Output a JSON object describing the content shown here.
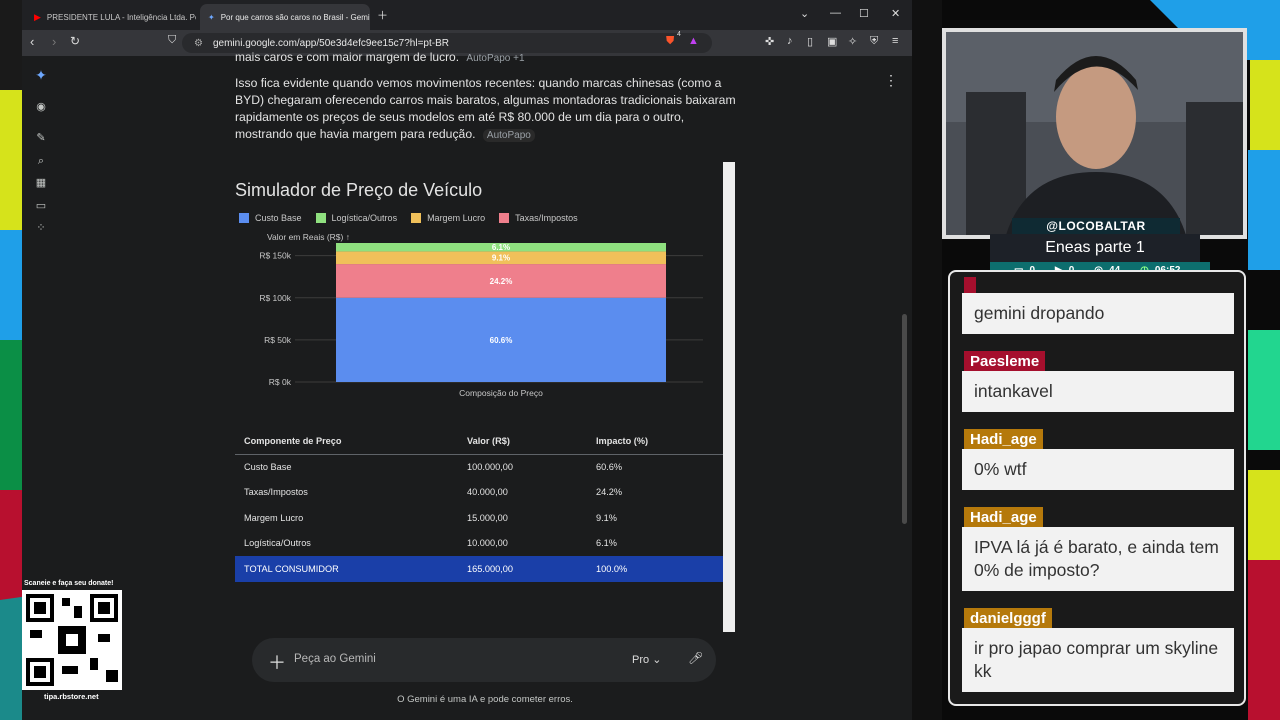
{
  "browser": {
    "tabs": [
      {
        "title": "PRESIDENTE LULA - Inteligência Ltda. Podcast",
        "active": false
      },
      {
        "title": "Por que carros são caros no Brasil - Gemini",
        "active": true
      }
    ],
    "url": "gemini.google.com/app/50e3d4efc9ee15c7?hl=pt-BR",
    "brave_badge": "4"
  },
  "gemini": {
    "cut_line": "mais caros e com maior margem de lucro.",
    "cut_source": "AutoPapo +1",
    "paragraph": "Isso fica evidente quando vemos movimentos recentes: quando marcas chinesas (como a BYD) chegaram oferecendo carros mais baratos, algumas montadoras tradicionais baixaram rapidamente os preços de seus modelos em até R$ 80.000 de um dia para o outro, mostrando que havia margem para redução.",
    "source_chip": "AutoPapo",
    "canvas_title": "Simulador de Preço de Veículo",
    "table": {
      "headers": [
        "Componente de Preço",
        "Valor (R$)",
        "Impacto (%)"
      ],
      "rows": [
        [
          "Custo Base",
          "100.000,00",
          "60.6%"
        ],
        [
          "Taxas/Impostos",
          "40.000,00",
          "24.2%"
        ],
        [
          "Margem Lucro",
          "15.000,00",
          "9.1%"
        ],
        [
          "Logística/Outros",
          "10.000,00",
          "6.1%"
        ],
        [
          "TOTAL CONSUMIDOR",
          "165.000,00",
          "100.0%"
        ]
      ]
    },
    "input_placeholder": "Peça ao Gemini",
    "model_label": "Pro",
    "disclaimer": "O Gemini é uma IA e pode cometer erros."
  },
  "chart_data": {
    "type": "bar",
    "stacked": true,
    "categories": [
      "Composição do Preço"
    ],
    "series": [
      {
        "name": "Custo Base",
        "values": [
          100000
        ],
        "label": "60.6%",
        "color": "#5b8def"
      },
      {
        "name": "Taxas/Impostos",
        "values": [
          40000
        ],
        "label": "24.2%",
        "color": "#ef7f8c"
      },
      {
        "name": "Margem Lucro",
        "values": [
          15000
        ],
        "label": "9.1%",
        "color": "#f0c05a"
      },
      {
        "name": "Logística/Outros",
        "values": [
          10000
        ],
        "label": "6.1%",
        "color": "#8fe07f"
      }
    ],
    "legend_order": [
      "Custo Base",
      "Logística/Outros",
      "Margem Lucro",
      "Taxas/Impostos"
    ],
    "ylabel": "Valor em Reais (R$) ↑",
    "yticks": [
      "R$ 0k",
      "R$ 50k",
      "R$ 100k",
      "R$ 150k"
    ],
    "ylim": [
      0,
      165000
    ],
    "grid": true,
    "legend_position": "top-left"
  },
  "stream": {
    "handle": "@LOCOBALTAR",
    "title": "Eneas parte 1",
    "stats": [
      "0",
      "0",
      "44",
      "06:52"
    ]
  },
  "chat": [
    {
      "user": "",
      "message": "gemini dropando",
      "color": "#a50f2d"
    },
    {
      "user": "Paesleme",
      "message": "intankavel",
      "color": "#a50f2d"
    },
    {
      "user": "Hadi_age",
      "message": "0% wtf",
      "color": "#b5790b"
    },
    {
      "user": "Hadi_age",
      "message": "IPVA lá já é barato, e ainda tem 0% de imposto?",
      "color": "#b5790b"
    },
    {
      "user": "danielgggf",
      "message": "ir pro japao comprar um skyline kk",
      "color": "#b5790b"
    }
  ],
  "donate": {
    "top_text": "Scaneie e faça seu donate!",
    "bottom_text": "tipa.rbstore.net"
  }
}
